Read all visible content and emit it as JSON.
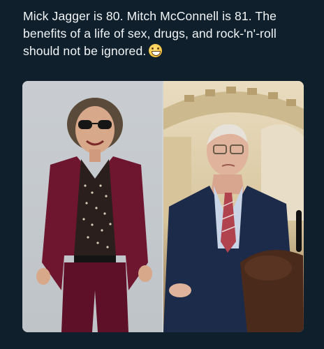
{
  "post": {
    "caption": "Mick Jagger is 80. Mitch McConnell is 81. The benefits of a life of sex, drugs, and rock-'n'-roll should not be ignored.",
    "emoji": "grinning-face-emoji"
  },
  "photos": [
    {
      "subject": "photo-mick-jagger"
    },
    {
      "subject": "photo-mitch-mcconnell"
    }
  ],
  "colors": {
    "background": "#0f1f2b",
    "text": "#f2f5f7",
    "suit_maroon": "#6e1530",
    "suit_navy": "#1c2b4a"
  }
}
